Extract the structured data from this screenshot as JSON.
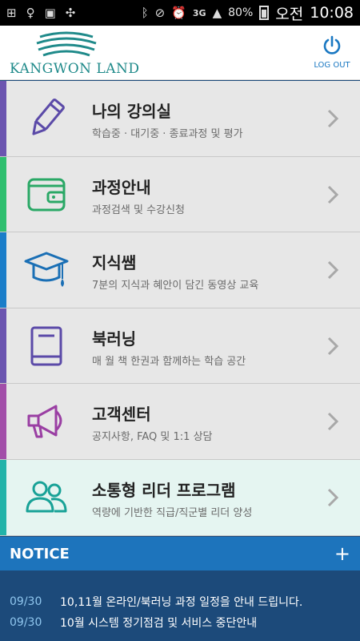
{
  "status_bar": {
    "battery": "80%",
    "network": "3G",
    "ampm": "오전",
    "time": "10:08"
  },
  "header": {
    "logo_text": "KANGWON LAND",
    "logout_label": "LOG OUT",
    "logout_icon": "power-icon"
  },
  "menu": [
    {
      "title": "나의 강의실",
      "subtitle": "학습중 · 대기중 · 종료과정 및 평가",
      "color": "#6b55b0",
      "icon": "pencil-icon"
    },
    {
      "title": "과정안내",
      "subtitle": "과정검색 및 수강신청",
      "color": "#2fbf6f",
      "icon": "wallet-icon"
    },
    {
      "title": "지식쌤",
      "subtitle": "7분의 지식과 혜안이 담긴 동영상 교육",
      "color": "#1a7dc9",
      "icon": "graduation-cap-icon"
    },
    {
      "title": "북러닝",
      "subtitle": "매 월 책 한권과 함께하는 학습 공간",
      "color": "#6b55b0",
      "icon": "book-icon"
    },
    {
      "title": "고객센터",
      "subtitle": "공지사항, FAQ 및 1:1 상담",
      "color": "#a24ea9",
      "icon": "megaphone-icon"
    },
    {
      "title": "소통형 리더 프로그램",
      "subtitle": "역량에 기반한 직급/직군별 리더 양성",
      "color": "#22b3a9",
      "icon": "users-icon"
    }
  ],
  "notice": {
    "title": "NOTICE",
    "more": "+",
    "items": [
      {
        "date": "09/30",
        "text": "10,11월 온라인/북러닝 과정 일정을 안내 드립니다."
      },
      {
        "date": "09/30",
        "text": "10월 시스템 정기점검 및 서비스 중단안내"
      }
    ]
  }
}
